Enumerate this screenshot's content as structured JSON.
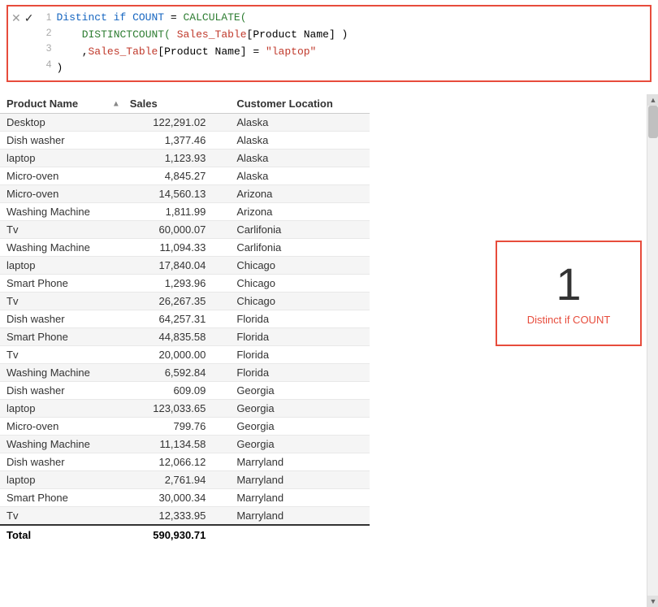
{
  "formula": {
    "line1_part1": "Distinct if COUNT = CALCULATE(",
    "line1_kw1": "Distinct if COUNT",
    "line1_eq": " = ",
    "line1_kw2": "CALCULATE(",
    "line2": "    DISTINCTCOUNT( Sales_Table[Product Name] )",
    "line3": "    ,Sales_Table[Product Name] = \"laptop\"",
    "line4": ")",
    "icons": {
      "x": "✕",
      "check": "✓"
    }
  },
  "table": {
    "headers": [
      "Product Name",
      "Sales",
      "Customer Location"
    ],
    "rows": [
      [
        "Desktop",
        "122,291.02",
        "Alaska"
      ],
      [
        "Dish washer",
        "1,377.46",
        "Alaska"
      ],
      [
        "laptop",
        "1,123.93",
        "Alaska"
      ],
      [
        "Micro-oven",
        "4,845.27",
        "Alaska"
      ],
      [
        "Micro-oven",
        "14,560.13",
        "Arizona"
      ],
      [
        "Washing Machine",
        "1,811.99",
        "Arizona"
      ],
      [
        "Tv",
        "60,000.07",
        "Carlifonia"
      ],
      [
        "Washing Machine",
        "11,094.33",
        "Carlifonia"
      ],
      [
        "laptop",
        "17,840.04",
        "Chicago"
      ],
      [
        "Smart Phone",
        "1,293.96",
        "Chicago"
      ],
      [
        "Tv",
        "26,267.35",
        "Chicago"
      ],
      [
        "Dish washer",
        "64,257.31",
        "Florida"
      ],
      [
        "Smart Phone",
        "44,835.58",
        "Florida"
      ],
      [
        "Tv",
        "20,000.00",
        "Florida"
      ],
      [
        "Washing Machine",
        "6,592.84",
        "Florida"
      ],
      [
        "Dish washer",
        "609.09",
        "Georgia"
      ],
      [
        "laptop",
        "123,033.65",
        "Georgia"
      ],
      [
        "Micro-oven",
        "799.76",
        "Georgia"
      ],
      [
        "Washing Machine",
        "11,134.58",
        "Georgia"
      ],
      [
        "Dish washer",
        "12,066.12",
        "Marryland"
      ],
      [
        "laptop",
        "2,761.94",
        "Marryland"
      ],
      [
        "Smart Phone",
        "30,000.34",
        "Marryland"
      ],
      [
        "Tv",
        "12,333.95",
        "Marryland"
      ]
    ],
    "footer": {
      "label": "Total",
      "value": "590,930.71"
    }
  },
  "kpi": {
    "value": "1",
    "label": "Distinct if COUNT"
  }
}
